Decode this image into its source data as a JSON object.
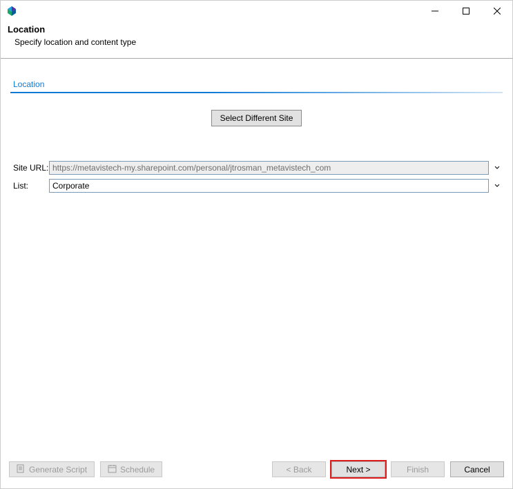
{
  "header": {
    "title": "Location",
    "subtitle": "Specify location and content type"
  },
  "section": {
    "label": "Location"
  },
  "buttons": {
    "select_different_site": "Select Different Site"
  },
  "form": {
    "site_url_label": "Site URL:",
    "site_url_value": "https://metavistech-my.sharepoint.com/personal/jtrosman_metavistech_com",
    "list_label": "List:",
    "list_value": "Corporate"
  },
  "footer": {
    "generate_script": "Generate Script",
    "schedule": "Schedule",
    "back": "< Back",
    "next": "Next >",
    "finish": "Finish",
    "cancel": "Cancel"
  }
}
